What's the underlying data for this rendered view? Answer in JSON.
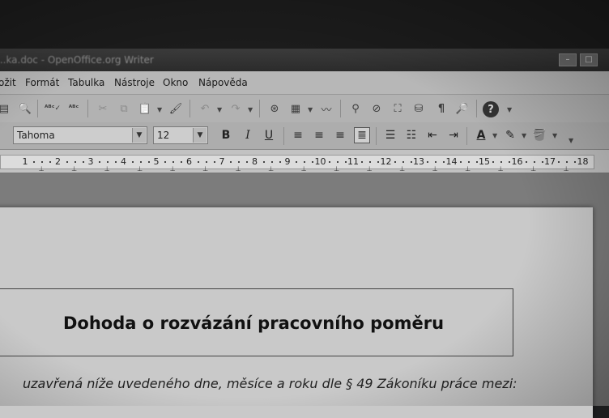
{
  "window": {
    "title": "...ka.doc - OpenOffice.org Writer",
    "minimize_label": "–",
    "maximize_label": "□"
  },
  "menubar": {
    "items": [
      "ožit",
      "Formát",
      "Tabulka",
      "Nástroje",
      "Okno",
      "Nápověda"
    ]
  },
  "toolbar_standard": {
    "icons": [
      "print-preview-icon",
      "spellcheck-icon",
      "autospellcheck-icon",
      "cut-icon",
      "copy-icon",
      "paste-icon",
      "format-paintbrush-icon",
      "undo-icon",
      "redo-icon",
      "navigator-icon",
      "table-icon",
      "draw-icon",
      "find-icon",
      "gallery-icon",
      "image-icon",
      "database-icon",
      "formatting-marks-icon",
      "zoom-icon",
      "help-icon"
    ]
  },
  "toolbar_formatting": {
    "font_name": "Tahoma",
    "font_size": "12",
    "bold_label": "B",
    "italic_label": "I",
    "underline_label": "U"
  },
  "ruler": {
    "numbers": [
      "1",
      "2",
      "3",
      "4",
      "5",
      "6",
      "7",
      "8",
      "9",
      "10",
      "11",
      "12",
      "13",
      "14",
      "15",
      "16",
      "17",
      "18"
    ]
  },
  "document": {
    "title": "Dohoda o rozvázání pracovního poměru",
    "line1": "uzavřená níže uvedeného dne, měsíce a roku dle § 49 Zákoníku práce mezi:"
  }
}
